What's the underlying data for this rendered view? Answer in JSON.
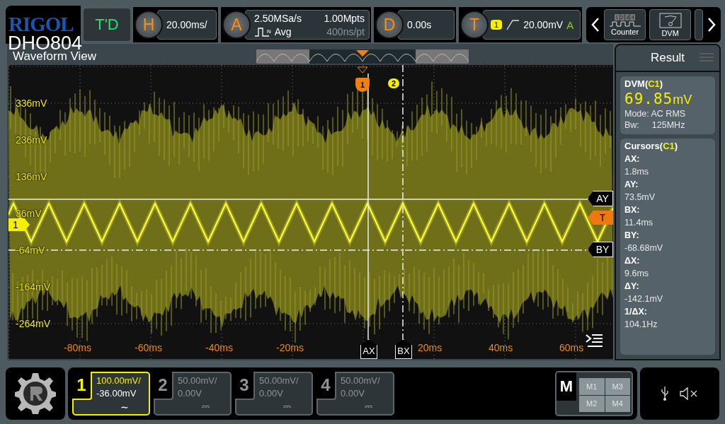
{
  "brand": {
    "logo": "RIGOL",
    "model": "DHO804"
  },
  "top_bar": {
    "trigger_status": "T'D",
    "horizontal": {
      "key": "H",
      "value": "20.00ms/"
    },
    "acquire": {
      "key": "A",
      "sample_rate": "2.50MSa/s",
      "pulse_label": "N",
      "mode": "Avg",
      "memory": "1.00Mpts",
      "resolution": "400ns/pt"
    },
    "delay": {
      "key": "D",
      "value": "0.00s"
    },
    "trigger": {
      "key": "T",
      "source": "1",
      "level": "20.00mV",
      "mode": "A"
    }
  },
  "tools": [
    {
      "kind": "counter",
      "label": "Counter",
      "digits": [
        "1",
        "2",
        "3",
        "4"
      ]
    },
    {
      "kind": "dvm",
      "label": "DVM"
    },
    {
      "kind": "more"
    }
  ],
  "waveform_view": {
    "title": "Waveform View",
    "y_labels": [
      "336mV",
      "236mV",
      "136mV",
      "36mV",
      "-64mV",
      "-164mV",
      "-264mV"
    ],
    "x_labels": [
      "-80ms",
      "-60ms",
      "-40ms",
      "-20ms",
      "20ms",
      "40ms",
      "60ms"
    ],
    "channel_marker": "1",
    "position_markers": [
      "1",
      "2"
    ],
    "cursor_tags": {
      "ay": "AY",
      "by": "BY",
      "ax": "AX",
      "bx": "BX"
    },
    "trigger_tag": "T"
  },
  "result": {
    "title": "Result",
    "dvm": {
      "label": "DVM(",
      "source": "C1",
      "close": ")",
      "value": "69.85",
      "unit": "mV",
      "mode": "Mode: AC RMS",
      "bw_label": "Bw:",
      "bw": "125MHz"
    },
    "cursors": {
      "label": "Cursors(",
      "source": "C1",
      "close": ")",
      "items": [
        {
          "label": "AX:",
          "value": "1.8ms"
        },
        {
          "label": "AY:",
          "value": "73.5mV"
        },
        {
          "label": "BX:",
          "value": "11.4ms"
        },
        {
          "label": "BY:",
          "value": "-68.68mV"
        },
        {
          "label": "ΔX:",
          "value": "9.6ms"
        },
        {
          "label": "ΔY:",
          "value": "-142.1mV"
        },
        {
          "label": "1/ΔX:",
          "value": "104.1Hz"
        }
      ]
    }
  },
  "channels": [
    {
      "number": "1",
      "scale": "100.00mV/",
      "offset": "-36.00mV",
      "coupling": "∼",
      "selected": true
    },
    {
      "number": "2",
      "scale": "50.00mV/",
      "offset": "0.00V",
      "coupling": "⎓",
      "selected": false
    },
    {
      "number": "3",
      "scale": "50.00mV/",
      "offset": "0.00V",
      "coupling": "⎓",
      "selected": false
    },
    {
      "number": "4",
      "scale": "50.00mV/",
      "offset": "0.00V",
      "coupling": "⎓",
      "selected": false
    }
  ],
  "math": {
    "label": "M",
    "items": [
      "M1",
      "M3",
      "M2",
      "M4"
    ]
  }
}
